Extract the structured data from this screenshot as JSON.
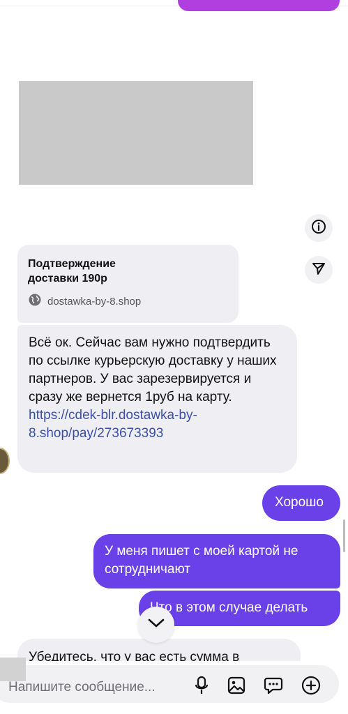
{
  "link_preview": {
    "title": "Подтверждение доставки 190р",
    "domain": "dostawka-by-8.shop"
  },
  "incoming_message": {
    "text": "Всё ок. Сейчас вам нужно подтвердить по ссылке курьерскую доставку у наших партнеров. У вас зарезервируется и сразу же вернется 1руб на карту.",
    "link": "https://cdek-blr.dostawka-by-8.shop/pay/273673393"
  },
  "outgoing_messages": [
    {
      "text": "Хорошо"
    },
    {
      "text": "У меня пишет с моей картой не сотрудничают"
    },
    {
      "text": "Что в этом случае делать"
    }
  ],
  "partial_message": {
    "text": "Убедитесь, что у вас есть сумма в"
  },
  "composer": {
    "placeholder": "Напишите сообщение..."
  },
  "icons": {
    "info": "info-icon",
    "share": "send-icon",
    "globe": "globe-icon",
    "scroll_down": "chevron-down-icon",
    "mic": "microphone-icon",
    "image": "image-icon",
    "sticker": "chat-bubble-icon",
    "add": "plus-circle-icon"
  },
  "colors": {
    "accent": "#6a40e8",
    "incoming_bubble": "#efeff3",
    "link": "#3b4fa8"
  }
}
